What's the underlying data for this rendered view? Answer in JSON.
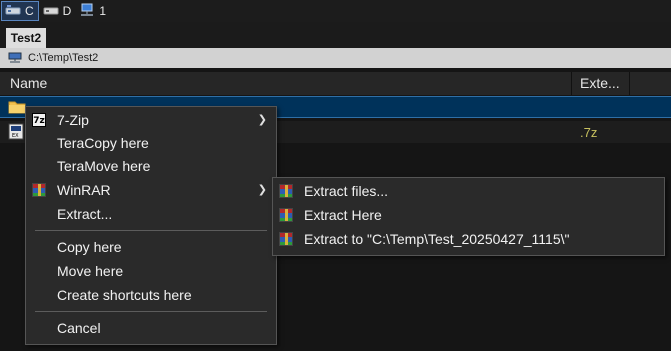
{
  "drives": [
    {
      "label": "C",
      "icon": "drive-icon",
      "active": true
    },
    {
      "label": "D",
      "icon": "drive-icon",
      "active": false
    },
    {
      "label": "1",
      "icon": "network-drive-icon",
      "active": false
    }
  ],
  "tab": {
    "label": "Test2"
  },
  "path": {
    "value": "C:\\Temp\\Test2",
    "icon": "network-folder-icon"
  },
  "columns": {
    "name": "Name",
    "ext": "Exte..."
  },
  "files": [
    {
      "icon": "folder-icon",
      "name": "",
      "ext": "",
      "selected": true
    },
    {
      "icon": "archive-file-icon",
      "name": "",
      "ext": ".7z",
      "selected": false
    }
  ],
  "context_menu": {
    "items": [
      {
        "label": "7-Zip",
        "icon": "sevenzip-icon",
        "submenu": true
      },
      {
        "label": "TeraCopy here",
        "icon": "",
        "submenu": false
      },
      {
        "label": "TeraMove here",
        "icon": "",
        "submenu": false
      },
      {
        "label": "WinRAR",
        "icon": "winrar-icon",
        "submenu": true
      },
      {
        "label": "Extract...",
        "icon": "",
        "submenu": false
      },
      {
        "label": "Copy here",
        "icon": "",
        "submenu": false
      },
      {
        "label": "Move here",
        "icon": "",
        "submenu": false
      },
      {
        "label": "Create shortcuts here",
        "icon": "",
        "submenu": false
      },
      {
        "label": "Cancel",
        "icon": "",
        "submenu": false
      }
    ]
  },
  "winrar_submenu": {
    "items": [
      {
        "label": "Extract files...",
        "icon": "winrar-icon"
      },
      {
        "label": "Extract Here",
        "icon": "winrar-icon"
      },
      {
        "label": "Extract to \"C:\\Temp\\Test_20250427_1115\\\"",
        "icon": "winrar-icon"
      }
    ]
  },
  "colors": {
    "selection": "#00325a",
    "menu_bg": "#2a2a2a",
    "ext_text": "#c7c15f"
  }
}
